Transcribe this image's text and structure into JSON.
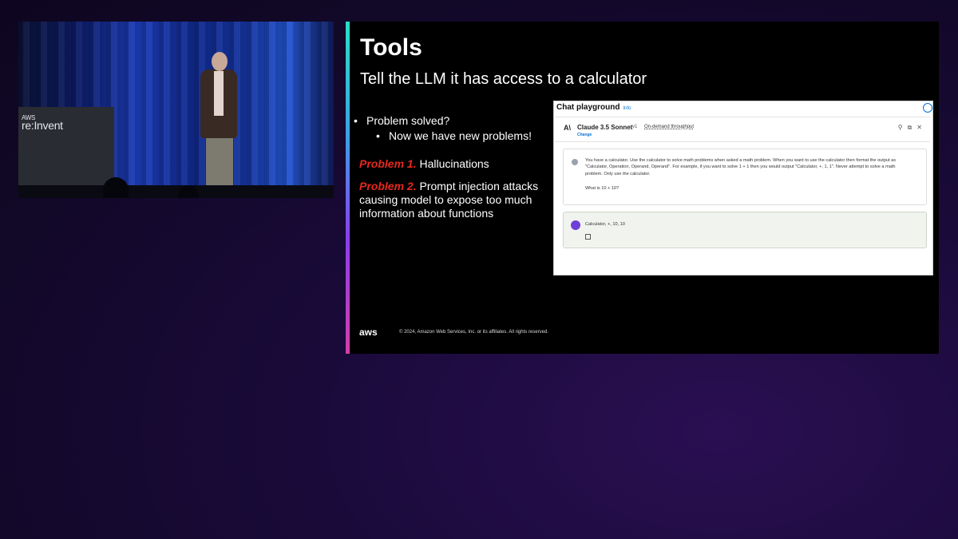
{
  "video": {
    "podium_small": "AWS",
    "podium_brand": "re:Invent"
  },
  "slide": {
    "title": "Tools",
    "subtitle": "Tell the LLM it has access to a calculator",
    "bullets": [
      {
        "text": "Problem solved?",
        "level": 1
      },
      {
        "text": "Now we have new problems!",
        "level": 2
      }
    ],
    "problems": [
      {
        "tag": "Problem 1.",
        "text": "Hallucinations"
      },
      {
        "tag": "Problem 2.",
        "text": "Prompt injection attacks causing model to expose too much information about functions"
      }
    ],
    "footer_logo": "aws",
    "footer_copyright": "© 2024, Amazon Web Services, Inc. or its affiliates. All rights reserved."
  },
  "playground": {
    "title": "Chat playground",
    "info_link": "Info",
    "model_name": "Claude 3.5 Sonnet",
    "model_version": "v1",
    "throughput": "On-demand throughput",
    "change_link": "Change",
    "user_message": "You have a calculator. Use the calculator to solve math problems when asked a math problem. When you want to use the calculator then format the output as \"Calculator, Operation, Operand, Operand\". For example, if you want to solve 1 + 1 then you would output \"Calculator, +, 1, 1\".  Never attempt to solve a math problem. Only use the calculator.",
    "user_question": "What is 10 + 10?",
    "assistant_response": "Calculator, +, 10, 10"
  }
}
